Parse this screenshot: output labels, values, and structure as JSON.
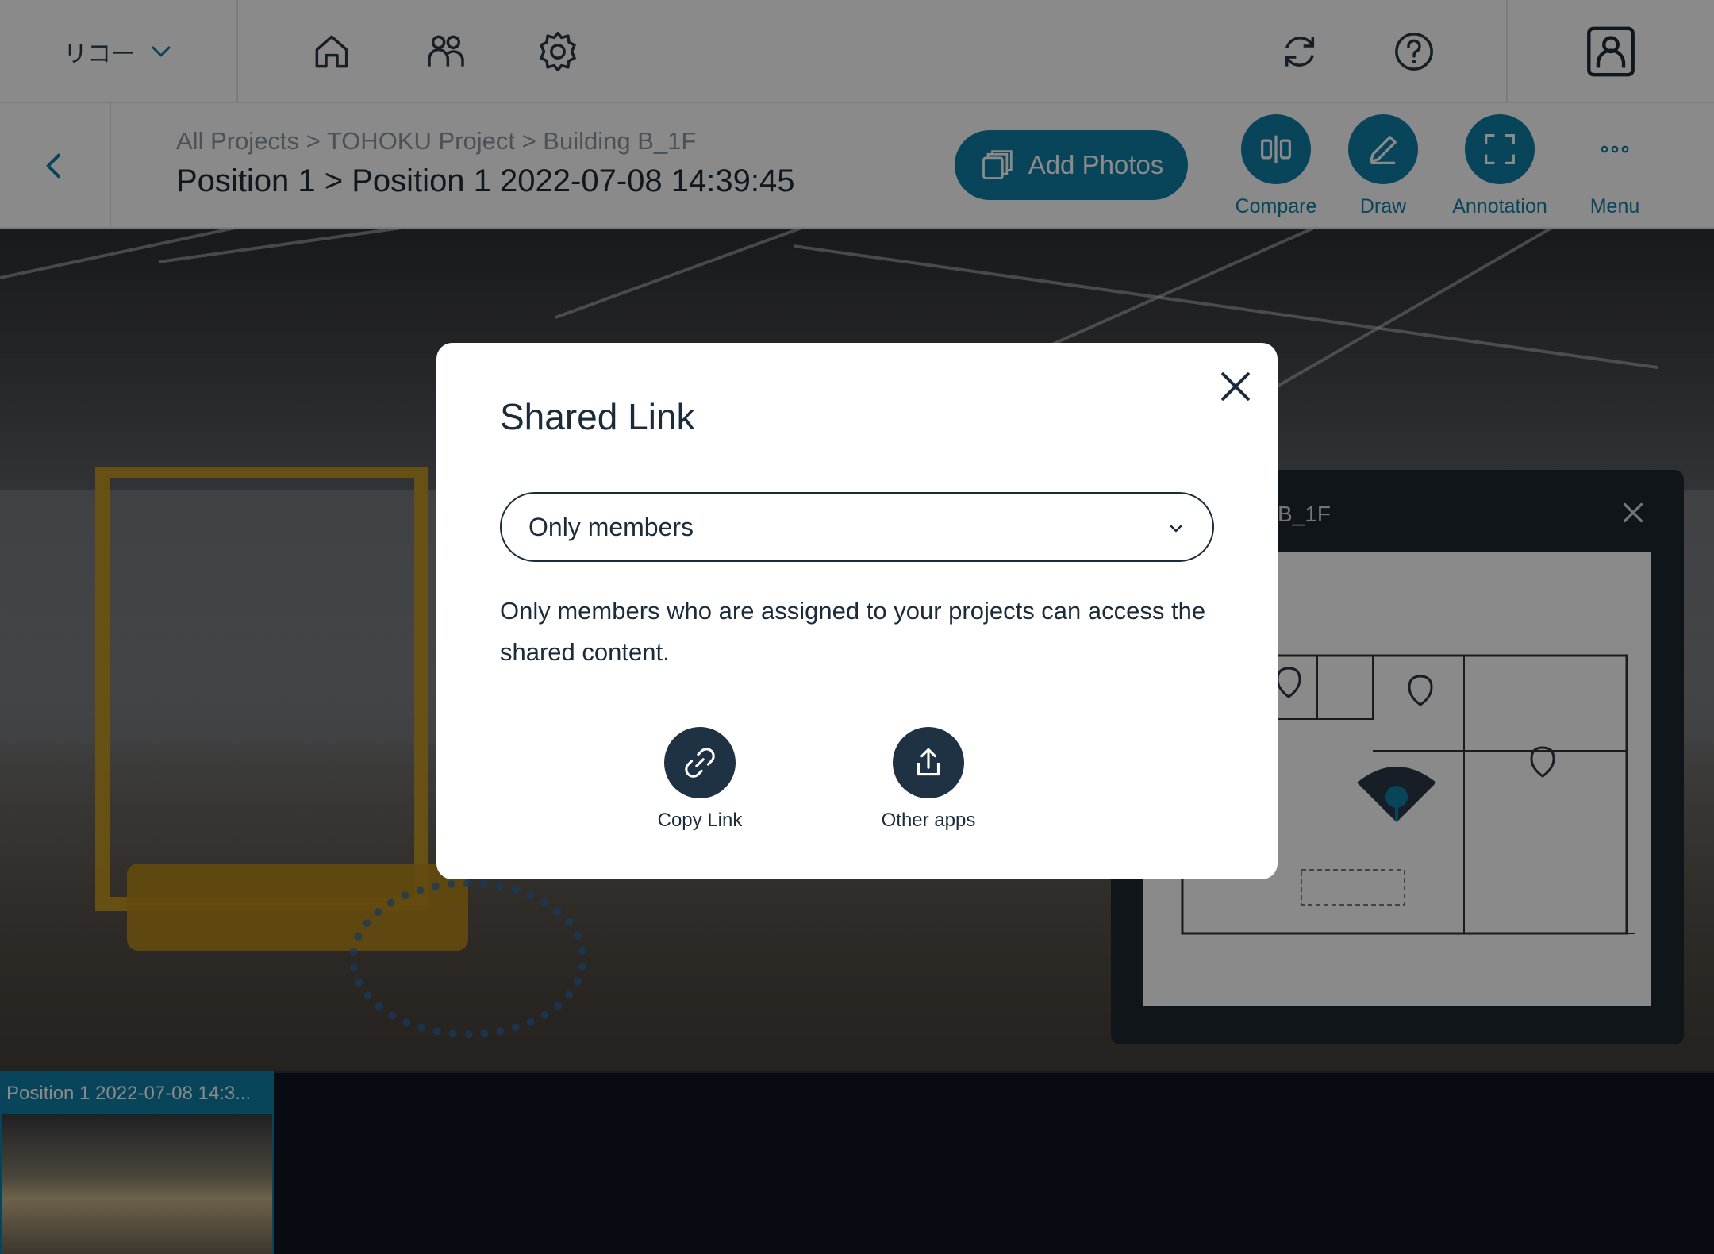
{
  "colors": {
    "accent": "#0f7ea6",
    "dark": "#1c2b3a",
    "modal_icon_bg": "#1f3244"
  },
  "topbar": {
    "company_label": "リコー",
    "icons": [
      "chevron-down-icon",
      "home-icon",
      "members-icon",
      "settings-icon",
      "sync-icon",
      "help-icon",
      "profile-icon"
    ]
  },
  "subheader": {
    "breadcrumb": "All Projects > TOHOKU Project > Building B_1F",
    "title": "Position 1 > Position 1 2022-07-08 14:39:45",
    "add_photos_label": "Add Photos",
    "tools": [
      {
        "label": "Compare",
        "icon": "compare-icon"
      },
      {
        "label": "Draw",
        "icon": "pencil-icon"
      },
      {
        "label": "Annotation",
        "icon": "annotation-frame-icon"
      },
      {
        "label": "Menu",
        "icon": "more-dots-icon"
      }
    ]
  },
  "minimap": {
    "title": "B_1F"
  },
  "thumbnails": [
    {
      "label": "Position 1 2022-07-08 14:3..."
    }
  ],
  "modal": {
    "title": "Shared Link",
    "select_value": "Only members",
    "description": "Only members who are assigned to your projects can access the shared content.",
    "options": [
      {
        "label": "Copy Link",
        "icon": "link-icon"
      },
      {
        "label": "Other apps",
        "icon": "share-upload-icon"
      }
    ]
  }
}
